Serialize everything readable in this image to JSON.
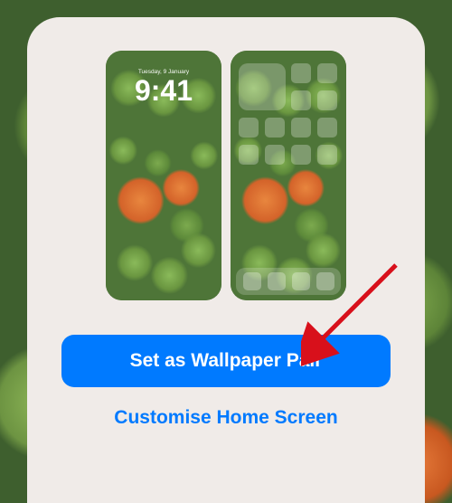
{
  "lockscreen": {
    "date": "Tuesday, 9 January",
    "time": "9:41"
  },
  "actions": {
    "primary_label": "Set as Wallpaper Pair",
    "secondary_label": "Customise Home Screen"
  },
  "colors": {
    "accent": "#007aff",
    "sheet_bg": "#f0ebe8"
  }
}
